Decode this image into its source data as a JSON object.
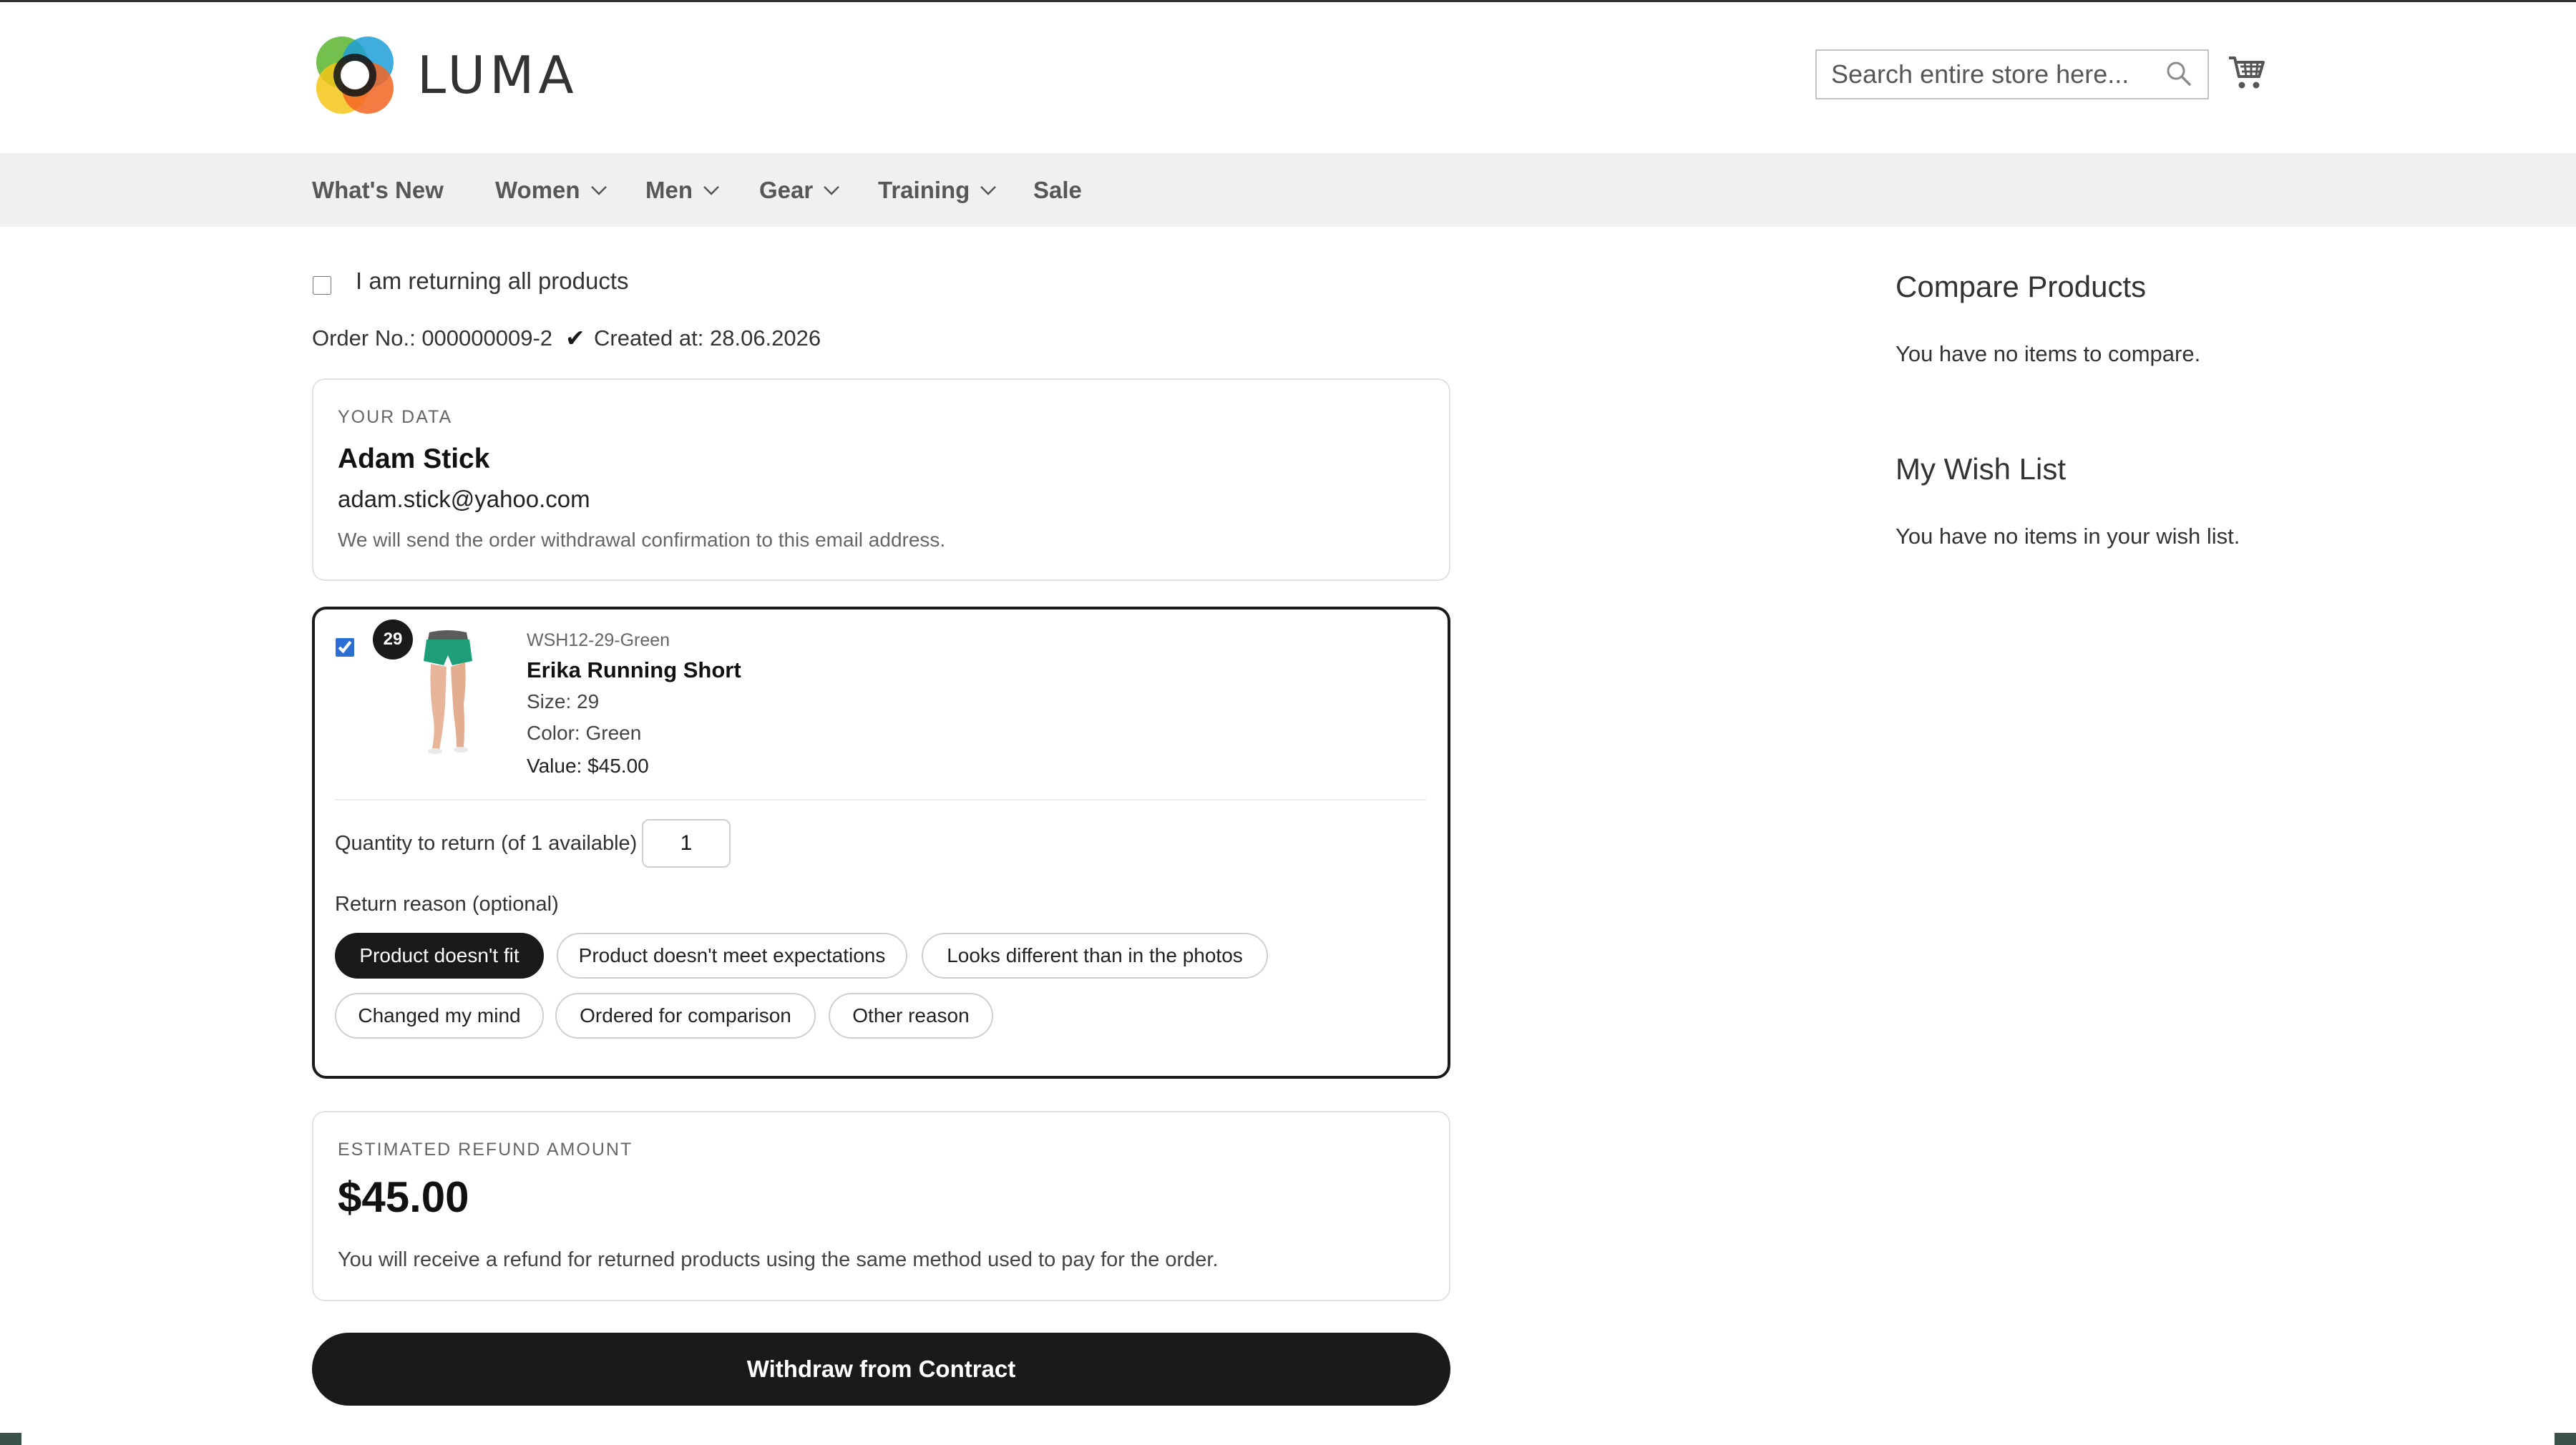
{
  "header": {
    "logo_text": "LUMA",
    "search_placeholder": "Search entire store here...",
    "icons": {
      "search": "search-icon",
      "cart": "cart-icon"
    }
  },
  "nav": {
    "items": [
      {
        "label": "What's New",
        "has_dropdown": false
      },
      {
        "label": "Women",
        "has_dropdown": true
      },
      {
        "label": "Men",
        "has_dropdown": true
      },
      {
        "label": "Gear",
        "has_dropdown": true
      },
      {
        "label": "Training",
        "has_dropdown": true
      },
      {
        "label": "Sale",
        "has_dropdown": false
      }
    ]
  },
  "main": {
    "return_all_label": "I am returning all products",
    "return_all_checked": false,
    "order_no": "Order No.: 000000009-2",
    "created_check": "✔",
    "created_at": "Created at: 28.06.2026",
    "your_data": {
      "eyebrow": "YOUR DATA",
      "name": "Adam Stick",
      "email": "adam.stick@yahoo.com",
      "note": "We will send the order withdrawal confirmation to this email address."
    },
    "item": {
      "checked": true,
      "badge": "29",
      "sku": "WSH12-29-Green",
      "name": "Erika Running Short",
      "size": "Size: 29",
      "color": "Color: Green",
      "value": "Value: $45.00",
      "qty_label": "Quantity to return (of 1 available)",
      "qty_value": "1",
      "reason_label": "Return reason (optional)",
      "reasons": [
        {
          "label": "Product doesn't fit",
          "selected": true
        },
        {
          "label": "Product doesn't meet expectations",
          "selected": false
        },
        {
          "label": "Looks different than in the photos",
          "selected": false
        },
        {
          "label": "Changed my mind",
          "selected": false
        },
        {
          "label": "Ordered for comparison",
          "selected": false
        },
        {
          "label": "Other reason",
          "selected": false
        }
      ]
    },
    "refund": {
      "eyebrow": "ESTIMATED REFUND AMOUNT",
      "amount": "$45.00",
      "note": "You will receive a refund for returned products using the same method used to pay for the order."
    },
    "submit_label": "Withdraw from Contract"
  },
  "sidebar": {
    "compare_title": "Compare Products",
    "compare_empty": "You have no items to compare.",
    "wishlist_title": "My Wish List",
    "wishlist_empty": "You have no items in your wish list."
  },
  "colors": {
    "accent_dark": "#1a1a1a",
    "nav_bg": "#f0f0f0",
    "checkbox_blue": "#2b6fd6"
  }
}
